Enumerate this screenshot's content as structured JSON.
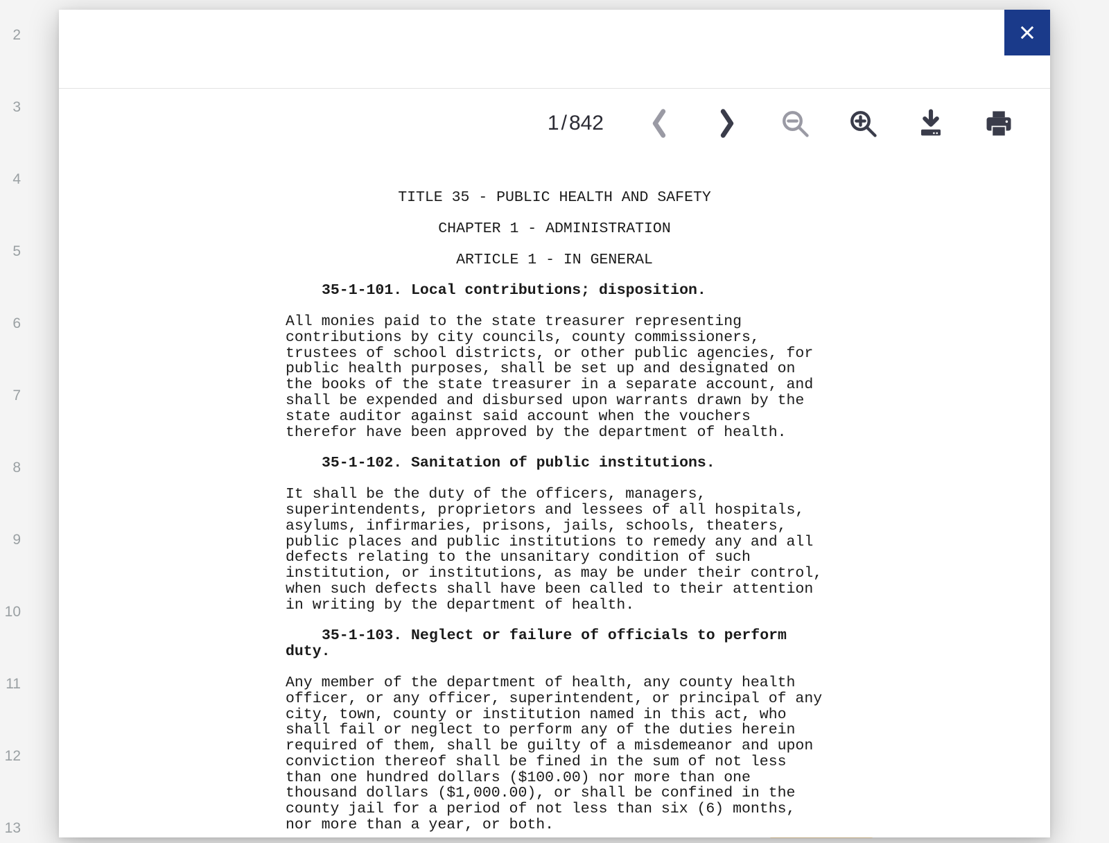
{
  "background": {
    "row_numbers": [
      2,
      3,
      4,
      5,
      6,
      7,
      8,
      9,
      10,
      11,
      12,
      13
    ]
  },
  "viewer": {
    "page_current": "1",
    "page_sep": "/",
    "page_total": "842"
  },
  "document": {
    "title_line": "TITLE 35 - PUBLIC HEALTH AND SAFETY",
    "chapter_line": "CHAPTER 1 - ADMINISTRATION",
    "article_line": "ARTICLE 1 - IN GENERAL",
    "sections": [
      {
        "heading": "35-1-101.  Local contributions; disposition.",
        "body": "All monies paid to the state treasurer representing contributions by city councils, county commissioners, trustees of school districts, or other public agencies, for public health purposes, shall be set up and designated on the books of the state treasurer in a separate account, and shall be expended and disbursed upon warrants drawn by the state auditor against said account when the vouchers therefor have been approved by the department of health."
      },
      {
        "heading": "35-1-102.  Sanitation of public institutions.",
        "body": "It shall be the duty of the officers, managers, superintendents, proprietors and lessees of all hospitals, asylums, infirmaries, prisons, jails, schools, theaters, public places and public institutions to remedy any and all defects relating to the unsanitary condition of such institution, or institutions, as may be under their control, when such defects shall have been called to their attention in writing by the department of health."
      },
      {
        "heading": "35-1-103.  Neglect or failure of officials to perform duty.",
        "body": "Any member of the department of health, any county health officer, or any officer, superintendent, or principal of any city, town, county or institution named in this act, who shall fail or neglect to perform any of the duties herein required of them, shall be guilty of a misdemeanor and upon conviction thereof shall be fined in the sum of not less than one hundred dollars ($100.00) nor more than one thousand dollars ($1,000.00), or shall be confined in the county jail for a period of not less than six (6) months, nor more than a year, or both."
      }
    ]
  }
}
